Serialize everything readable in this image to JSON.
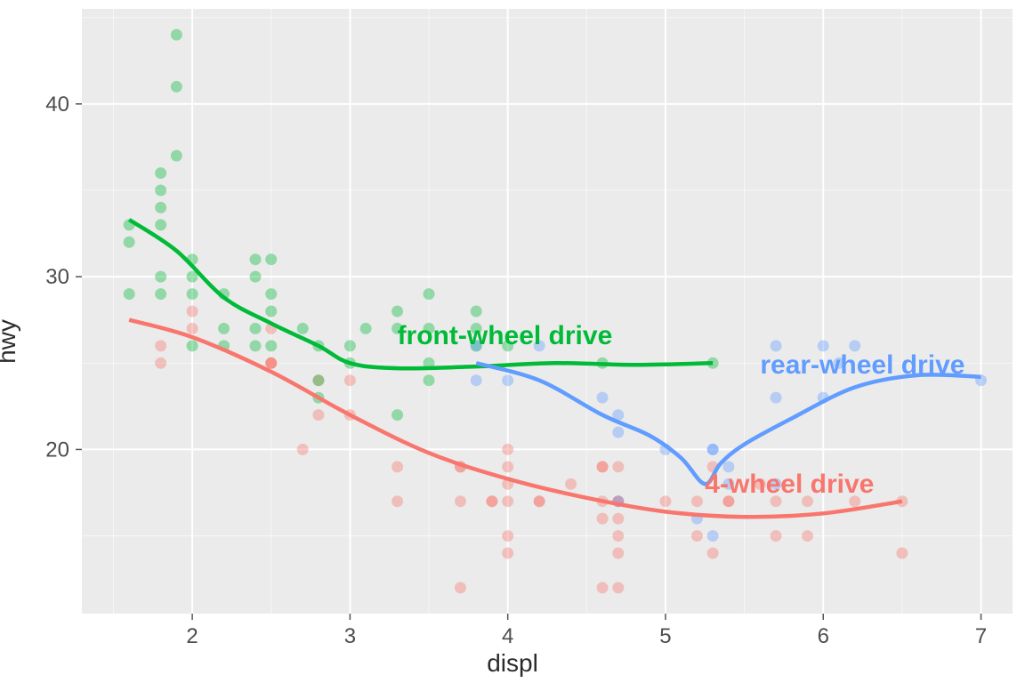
{
  "chart_data": {
    "type": "scatter",
    "xlabel": "displ",
    "ylabel": "hwy",
    "x_ticks": [
      2,
      3,
      4,
      5,
      6,
      7
    ],
    "y_ticks": [
      20,
      30,
      40
    ],
    "xlim": [
      1.3,
      7.2
    ],
    "ylim": [
      10.5,
      45.5
    ],
    "series": [
      {
        "name": "4-wheel drive",
        "label": "4-wheel drive",
        "color": "#F8766D",
        "points": [
          {
            "x": 1.8,
            "y": 26
          },
          {
            "x": 1.8,
            "y": 25
          },
          {
            "x": 2.0,
            "y": 28
          },
          {
            "x": 2.0,
            "y": 27
          },
          {
            "x": 2.5,
            "y": 25
          },
          {
            "x": 2.5,
            "y": 25
          },
          {
            "x": 2.5,
            "y": 27
          },
          {
            "x": 2.5,
            "y": 25
          },
          {
            "x": 2.7,
            "y": 20
          },
          {
            "x": 2.8,
            "y": 24
          },
          {
            "x": 2.8,
            "y": 22
          },
          {
            "x": 3.0,
            "y": 24
          },
          {
            "x": 3.0,
            "y": 22
          },
          {
            "x": 3.3,
            "y": 19
          },
          {
            "x": 3.3,
            "y": 17
          },
          {
            "x": 3.7,
            "y": 19
          },
          {
            "x": 3.7,
            "y": 19
          },
          {
            "x": 3.7,
            "y": 17
          },
          {
            "x": 3.7,
            "y": 12
          },
          {
            "x": 3.9,
            "y": 17
          },
          {
            "x": 3.9,
            "y": 17
          },
          {
            "x": 4.0,
            "y": 20
          },
          {
            "x": 4.0,
            "y": 18
          },
          {
            "x": 4.0,
            "y": 15
          },
          {
            "x": 4.0,
            "y": 17
          },
          {
            "x": 4.0,
            "y": 19
          },
          {
            "x": 4.0,
            "y": 14
          },
          {
            "x": 4.2,
            "y": 17
          },
          {
            "x": 4.2,
            "y": 17
          },
          {
            "x": 4.4,
            "y": 18
          },
          {
            "x": 4.6,
            "y": 19
          },
          {
            "x": 4.6,
            "y": 19
          },
          {
            "x": 4.6,
            "y": 17
          },
          {
            "x": 4.6,
            "y": 16
          },
          {
            "x": 4.6,
            "y": 12
          },
          {
            "x": 4.7,
            "y": 19
          },
          {
            "x": 4.7,
            "y": 17
          },
          {
            "x": 4.7,
            "y": 17
          },
          {
            "x": 4.7,
            "y": 16
          },
          {
            "x": 4.7,
            "y": 15
          },
          {
            "x": 4.7,
            "y": 14
          },
          {
            "x": 4.7,
            "y": 12
          },
          {
            "x": 5.0,
            "y": 17
          },
          {
            "x": 5.2,
            "y": 17
          },
          {
            "x": 5.2,
            "y": 15
          },
          {
            "x": 5.3,
            "y": 19
          },
          {
            "x": 5.3,
            "y": 14
          },
          {
            "x": 5.4,
            "y": 17
          },
          {
            "x": 5.4,
            "y": 17
          },
          {
            "x": 5.6,
            "y": 18
          },
          {
            "x": 5.7,
            "y": 17
          },
          {
            "x": 5.7,
            "y": 15
          },
          {
            "x": 5.9,
            "y": 17
          },
          {
            "x": 5.9,
            "y": 15
          },
          {
            "x": 6.2,
            "y": 17
          },
          {
            "x": 6.5,
            "y": 17
          },
          {
            "x": 6.5,
            "y": 14
          }
        ],
        "smooth": [
          {
            "x": 1.6,
            "y": 27.5
          },
          {
            "x": 2.0,
            "y": 26.5
          },
          {
            "x": 2.5,
            "y": 24.5
          },
          {
            "x": 3.0,
            "y": 22.0
          },
          {
            "x": 3.5,
            "y": 19.8
          },
          {
            "x": 4.0,
            "y": 18.3
          },
          {
            "x": 4.5,
            "y": 17.2
          },
          {
            "x": 5.0,
            "y": 16.4
          },
          {
            "x": 5.5,
            "y": 16.1
          },
          {
            "x": 6.0,
            "y": 16.3
          },
          {
            "x": 6.5,
            "y": 17.0
          }
        ],
        "label_pos": {
          "x": 5.25,
          "y": 17.5
        }
      },
      {
        "name": "front-wheel drive",
        "label": "front-wheel drive",
        "color": "#00BA38",
        "points": [
          {
            "x": 1.6,
            "y": 33
          },
          {
            "x": 1.6,
            "y": 32
          },
          {
            "x": 1.6,
            "y": 29
          },
          {
            "x": 1.8,
            "y": 36
          },
          {
            "x": 1.8,
            "y": 35
          },
          {
            "x": 1.8,
            "y": 34
          },
          {
            "x": 1.8,
            "y": 33
          },
          {
            "x": 1.8,
            "y": 30
          },
          {
            "x": 1.8,
            "y": 29
          },
          {
            "x": 1.9,
            "y": 44
          },
          {
            "x": 1.9,
            "y": 41
          },
          {
            "x": 1.9,
            "y": 37
          },
          {
            "x": 2.0,
            "y": 31
          },
          {
            "x": 2.0,
            "y": 30
          },
          {
            "x": 2.0,
            "y": 29
          },
          {
            "x": 2.0,
            "y": 26
          },
          {
            "x": 2.2,
            "y": 29
          },
          {
            "x": 2.2,
            "y": 27
          },
          {
            "x": 2.2,
            "y": 26
          },
          {
            "x": 2.4,
            "y": 31
          },
          {
            "x": 2.4,
            "y": 30
          },
          {
            "x": 2.4,
            "y": 27
          },
          {
            "x": 2.4,
            "y": 26
          },
          {
            "x": 2.5,
            "y": 31
          },
          {
            "x": 2.5,
            "y": 29
          },
          {
            "x": 2.5,
            "y": 28
          },
          {
            "x": 2.5,
            "y": 26
          },
          {
            "x": 2.7,
            "y": 27
          },
          {
            "x": 2.8,
            "y": 26
          },
          {
            "x": 2.8,
            "y": 24
          },
          {
            "x": 2.8,
            "y": 23
          },
          {
            "x": 3.0,
            "y": 26
          },
          {
            "x": 3.0,
            "y": 25
          },
          {
            "x": 3.1,
            "y": 27
          },
          {
            "x": 3.3,
            "y": 28
          },
          {
            "x": 3.3,
            "y": 27
          },
          {
            "x": 3.3,
            "y": 22
          },
          {
            "x": 3.5,
            "y": 29
          },
          {
            "x": 3.5,
            "y": 27
          },
          {
            "x": 3.5,
            "y": 25
          },
          {
            "x": 3.5,
            "y": 24
          },
          {
            "x": 3.8,
            "y": 28
          },
          {
            "x": 3.8,
            "y": 27
          },
          {
            "x": 3.8,
            "y": 26
          },
          {
            "x": 4.0,
            "y": 26
          },
          {
            "x": 4.6,
            "y": 25
          },
          {
            "x": 5.3,
            "y": 25
          }
        ],
        "smooth": [
          {
            "x": 1.6,
            "y": 33.3
          },
          {
            "x": 1.9,
            "y": 31.5
          },
          {
            "x": 2.2,
            "y": 28.8
          },
          {
            "x": 2.5,
            "y": 27.3
          },
          {
            "x": 2.8,
            "y": 26.0
          },
          {
            "x": 3.0,
            "y": 25.0
          },
          {
            "x": 3.3,
            "y": 24.7
          },
          {
            "x": 3.8,
            "y": 24.8
          },
          {
            "x": 4.3,
            "y": 25.0
          },
          {
            "x": 4.8,
            "y": 24.9
          },
          {
            "x": 5.3,
            "y": 25.0
          }
        ],
        "label_pos": {
          "x": 3.3,
          "y": 26.1
        }
      },
      {
        "name": "rear-wheel drive",
        "label": "rear-wheel drive",
        "color": "#619CFF",
        "points": [
          {
            "x": 3.8,
            "y": 26
          },
          {
            "x": 3.8,
            "y": 24
          },
          {
            "x": 4.0,
            "y": 24
          },
          {
            "x": 4.2,
            "y": 26
          },
          {
            "x": 4.6,
            "y": 23
          },
          {
            "x": 4.7,
            "y": 22
          },
          {
            "x": 4.7,
            "y": 21
          },
          {
            "x": 4.7,
            "y": 17
          },
          {
            "x": 5.0,
            "y": 20
          },
          {
            "x": 5.2,
            "y": 16
          },
          {
            "x": 5.3,
            "y": 20
          },
          {
            "x": 5.3,
            "y": 20
          },
          {
            "x": 5.3,
            "y": 15
          },
          {
            "x": 5.4,
            "y": 19
          },
          {
            "x": 5.4,
            "y": 18
          },
          {
            "x": 5.7,
            "y": 26
          },
          {
            "x": 5.7,
            "y": 23
          },
          {
            "x": 5.7,
            "y": 18
          },
          {
            "x": 6.0,
            "y": 26
          },
          {
            "x": 6.0,
            "y": 23
          },
          {
            "x": 6.1,
            "y": 25
          },
          {
            "x": 6.2,
            "y": 26
          },
          {
            "x": 7.0,
            "y": 24
          }
        ],
        "smooth": [
          {
            "x": 3.8,
            "y": 25.0
          },
          {
            "x": 4.2,
            "y": 24.0
          },
          {
            "x": 4.6,
            "y": 22.0
          },
          {
            "x": 4.9,
            "y": 20.8
          },
          {
            "x": 5.1,
            "y": 19.5
          },
          {
            "x": 5.25,
            "y": 18.0
          },
          {
            "x": 5.35,
            "y": 19.2
          },
          {
            "x": 5.5,
            "y": 20.3
          },
          {
            "x": 5.8,
            "y": 21.8
          },
          {
            "x": 6.2,
            "y": 23.6
          },
          {
            "x": 6.6,
            "y": 24.3
          },
          {
            "x": 7.0,
            "y": 24.2
          }
        ],
        "label_pos": {
          "x": 5.6,
          "y": 24.4
        }
      }
    ]
  }
}
